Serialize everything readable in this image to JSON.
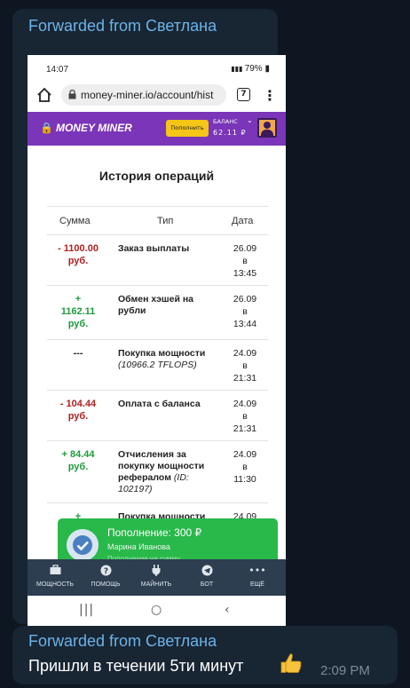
{
  "message1": {
    "forwarded": "Forwarded from Светлана"
  },
  "phone": {
    "status_time": "14:07",
    "status_right": "79%",
    "url": "money-miner.io/account/hist",
    "tab_count": "7"
  },
  "site": {
    "brand": "MONEY MINER",
    "topup_label": "Пополнить",
    "balance_label": "БАЛАНС",
    "balance_value": "62.11 ₽",
    "page_title": "История операций"
  },
  "table": {
    "headers": [
      "Сумма",
      "Тип",
      "Дата"
    ],
    "rows": [
      {
        "amount": [
          "- 1100.00",
          "руб."
        ],
        "kind": "neg",
        "type": "Заказ выплаты",
        "type_note": "",
        "date": [
          "26.09",
          "в",
          "13:45"
        ]
      },
      {
        "amount": [
          "+",
          "1162.11",
          "руб."
        ],
        "kind": "pos",
        "type": "Обмен хэшей на рубли",
        "type_note": "",
        "date": [
          "26.09",
          "в",
          "13:44"
        ]
      },
      {
        "amount": [
          "---"
        ],
        "kind": "neutral",
        "type": "Покупка мощности",
        "type_note": "(10966.2 TFLOPS)",
        "date": [
          "24.09",
          "в",
          "21:31"
        ]
      },
      {
        "amount": [
          "- 104.44",
          "руб."
        ],
        "kind": "neg",
        "type": "Оплата с баланса",
        "type_note": "",
        "date": [
          "24.09",
          "в",
          "21:31"
        ]
      },
      {
        "amount": [
          "+ 84.44",
          "руб."
        ],
        "kind": "pos",
        "type": "Отчисления за покупку мощности рефералом",
        "type_note": "(ID: 102197)",
        "date": [
          "24.09",
          "в",
          "11:30"
        ]
      },
      {
        "amount": [
          "+"
        ],
        "kind": "pos",
        "type": "Покупка мощности",
        "type_note": "",
        "date": [
          "24.09"
        ]
      }
    ]
  },
  "toast": {
    "title": "Пополнение: 300 ₽",
    "name": "Марина Иванова",
    "sub": "Пополнение на сумму"
  },
  "bottom_nav": [
    {
      "label": "МОЩНОСТЬ",
      "icon": "briefcase-icon"
    },
    {
      "label": "ПОМОЩЬ",
      "icon": "help-icon"
    },
    {
      "label": "МАЙНИТЬ",
      "icon": "plug-icon"
    },
    {
      "label": "БОТ",
      "icon": "telegram-icon"
    },
    {
      "label": "ЕЩЁ",
      "icon": "more-icon"
    }
  ],
  "message2": {
    "forwarded": "Forwarded from Светлана",
    "text": "Пришли в течении 5ти минут",
    "time": "2:09 PM"
  },
  "colors": {
    "accent_purple": "#7a35b8",
    "positive": "#1f9a3b",
    "negative": "#b02020",
    "toast_green": "#29b84a",
    "telegram_link": "#6cb3e8"
  }
}
